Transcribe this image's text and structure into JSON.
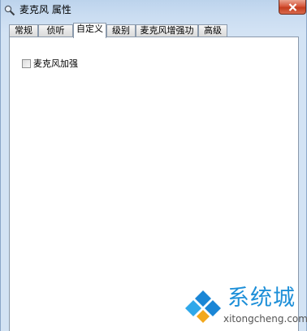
{
  "window": {
    "title": "麦克风 属性"
  },
  "tabs": [
    {
      "label": "常规",
      "active": false
    },
    {
      "label": "侦听",
      "active": false
    },
    {
      "label": "自定义",
      "active": true
    },
    {
      "label": "级别",
      "active": false
    },
    {
      "label": "麦克风增强功能",
      "active": false
    },
    {
      "label": "高级",
      "active": false
    }
  ],
  "panel": {
    "checkbox_label": "麦克风加强",
    "checkbox_checked": false
  },
  "watermark": {
    "brand": "系统城",
    "url": "xitongcheng.com"
  },
  "icons": {
    "title": "microphone-icon",
    "close": "close-icon",
    "watermark": "windows-logo-icon"
  },
  "colors": {
    "close_button": "#d6573c",
    "watermark_blue": "#1d8fd8"
  }
}
